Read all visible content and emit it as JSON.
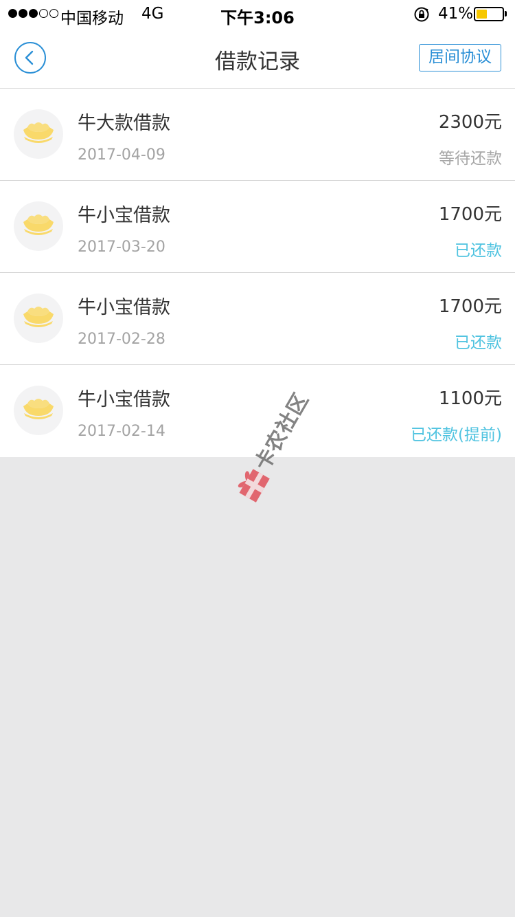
{
  "status_bar": {
    "carrier": "中国移动",
    "network": "4G",
    "time": "下午3:06",
    "battery_percent": "41%",
    "battery_level": 0.41,
    "signal_bars_filled": 3,
    "signal_bars_total": 5
  },
  "nav": {
    "back_icon": "chevron-left-icon",
    "title": "借款记录",
    "agreement_label": "居间协议"
  },
  "colors": {
    "accent_blue": "#2a8fd6",
    "repaid_cyan": "#4fc3e0",
    "pending_gray": "#a7a7a7",
    "gold_ingot": "#f9d96a",
    "background_gray": "#e8e8e9"
  },
  "loans": [
    {
      "icon": "gold-ingot-icon",
      "name": "牛大款借款",
      "date": "2017-04-09",
      "amount": "2300元",
      "status": "等待还款",
      "status_type": "pending"
    },
    {
      "icon": "gold-ingot-icon",
      "name": "牛小宝借款",
      "date": "2017-03-20",
      "amount": "1700元",
      "status": "已还款",
      "status_type": "repaid"
    },
    {
      "icon": "gold-ingot-icon",
      "name": "牛小宝借款",
      "date": "2017-02-28",
      "amount": "1700元",
      "status": "已还款",
      "status_type": "repaid"
    },
    {
      "icon": "gold-ingot-icon",
      "name": "牛小宝借款",
      "date": "2017-02-14",
      "amount": "1100元",
      "status": "已还款(提前)",
      "status_type": "repaid"
    }
  ],
  "watermark": {
    "text": "卡农社区",
    "icon": "gift-box-logo-icon"
  }
}
